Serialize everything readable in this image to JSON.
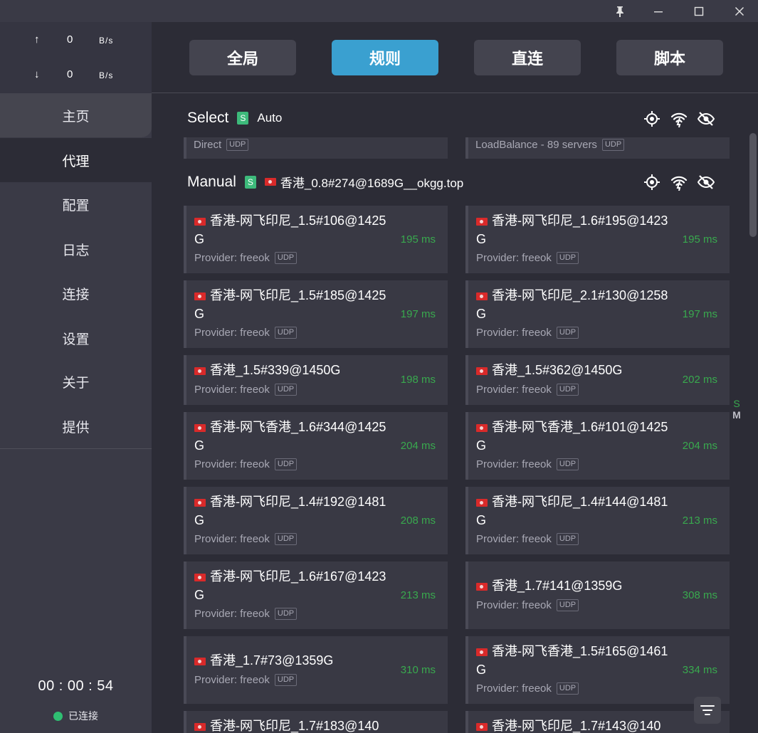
{
  "sidebar": {
    "upload_arrow": "↑",
    "upload_value": "0",
    "upload_unit": "B/s",
    "download_arrow": "↓",
    "download_value": "0",
    "download_unit": "B/s",
    "nav": [
      {
        "label": "主页"
      },
      {
        "label": "代理"
      },
      {
        "label": "配置"
      },
      {
        "label": "日志"
      },
      {
        "label": "连接"
      },
      {
        "label": "设置"
      },
      {
        "label": "关于"
      },
      {
        "label": "提供"
      }
    ],
    "timer": "00 : 00 : 54",
    "status": "已连接"
  },
  "modes": [
    {
      "label": "全局",
      "active": false
    },
    {
      "label": "规则",
      "active": true
    },
    {
      "label": "直连",
      "active": false
    },
    {
      "label": "脚本",
      "active": false
    }
  ],
  "groups": {
    "select": {
      "name": "Select",
      "badge": "S",
      "selected": "Auto"
    },
    "partial": [
      {
        "text": "Direct",
        "tag": "UDP"
      },
      {
        "text": "LoadBalance - 89 servers",
        "tag": "UDP"
      }
    ],
    "manual": {
      "name": "Manual",
      "badge": "S",
      "selected": "香港_0.8#274@1689G__okgg.top"
    }
  },
  "proxies": [
    {
      "name": "香港-网飞印尼_1.5#106@1425G",
      "provider": "Provider: freeok",
      "tag": "UDP",
      "delay": "195 ms"
    },
    {
      "name": "香港-网飞印尼_1.6#195@1423G",
      "provider": "Provider: freeok",
      "tag": "UDP",
      "delay": "195 ms"
    },
    {
      "name": "香港-网飞印尼_1.5#185@1425G",
      "provider": "Provider: freeok",
      "tag": "UDP",
      "delay": "197 ms"
    },
    {
      "name": "香港-网飞印尼_2.1#130@1258G",
      "provider": "Provider: freeok",
      "tag": "UDP",
      "delay": "197 ms"
    },
    {
      "name": "香港_1.5#339@1450G",
      "provider": "Provider: freeok",
      "tag": "UDP",
      "delay": "198 ms"
    },
    {
      "name": "香港_1.5#362@1450G",
      "provider": "Provider: freeok",
      "tag": "UDP",
      "delay": "202 ms"
    },
    {
      "name": "香港-网飞香港_1.6#344@1425G",
      "provider": "Provider: freeok",
      "tag": "UDP",
      "delay": "204 ms"
    },
    {
      "name": "香港-网飞香港_1.6#101@1425G",
      "provider": "Provider: freeok",
      "tag": "UDP",
      "delay": "204 ms"
    },
    {
      "name": "香港-网飞印尼_1.4#192@1481G",
      "provider": "Provider: freeok",
      "tag": "UDP",
      "delay": "208 ms"
    },
    {
      "name": "香港-网飞印尼_1.4#144@1481G",
      "provider": "Provider: freeok",
      "tag": "UDP",
      "delay": "213 ms"
    },
    {
      "name": "香港-网飞印尼_1.6#167@1423G",
      "provider": "Provider: freeok",
      "tag": "UDP",
      "delay": "213 ms"
    },
    {
      "name": "香港_1.7#141@1359G",
      "provider": "Provider: freeok",
      "tag": "UDP",
      "delay": "308 ms"
    },
    {
      "name": "香港_1.7#73@1359G",
      "provider": "Provider: freeok",
      "tag": "UDP",
      "delay": "310 ms"
    },
    {
      "name": "香港-网飞香港_1.5#165@1461G",
      "provider": "Provider: freeok",
      "tag": "UDP",
      "delay": "334 ms"
    },
    {
      "name": "香港-网飞印尼_1.7#183@140",
      "provider": "",
      "tag": "",
      "delay": ""
    },
    {
      "name": "香港-网飞印尼_1.7#143@140",
      "provider": "",
      "tag": "",
      "delay": ""
    }
  ],
  "right_rail": {
    "s": "S",
    "m": "M"
  },
  "icons": {
    "pin": "pin-icon",
    "minimize": "minimize-icon",
    "maximize": "maximize-icon",
    "close": "close-icon",
    "locate": "locate-icon",
    "speedtest": "speedtest-icon",
    "hide": "eye-off-icon",
    "filter": "filter-icon"
  },
  "colors": {
    "accent": "#3aa0d0",
    "connected": "#2fbf72",
    "delay_ok": "#39a94e",
    "badge": "#3dba7b"
  }
}
